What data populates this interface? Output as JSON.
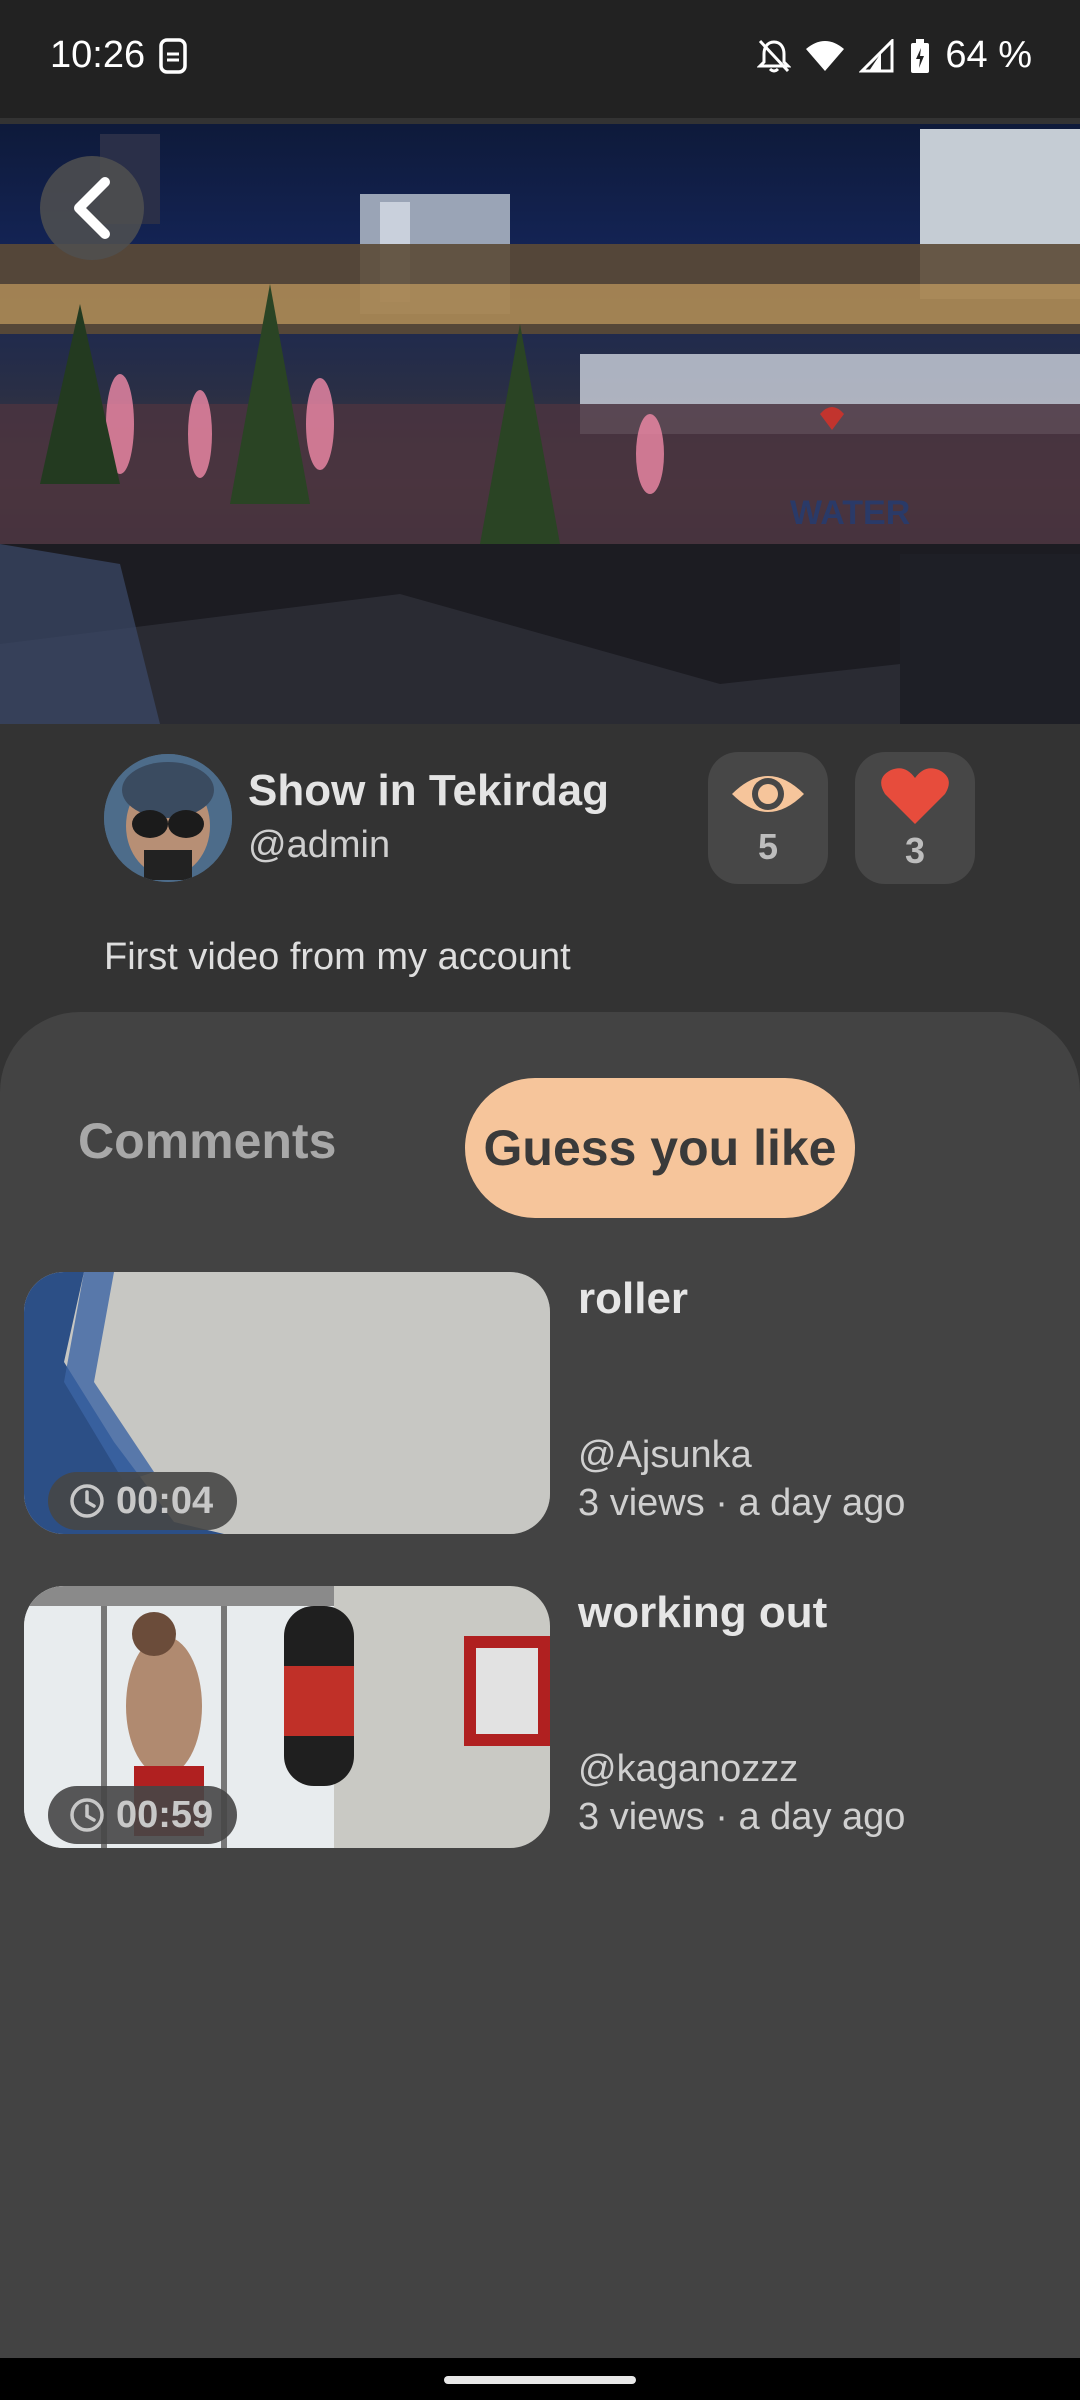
{
  "status_bar": {
    "time": "10:26",
    "battery": "64 %",
    "icons": [
      "dnd-off-icon",
      "wifi-icon",
      "signal-icon",
      "battery-icon"
    ]
  },
  "video": {
    "back_icon": "chevron-left-icon"
  },
  "post": {
    "title": "Show in Tekirdag",
    "author": "@admin",
    "views": "5",
    "likes": "3",
    "description": "First video from my account"
  },
  "tabs": {
    "comments": "Comments",
    "guess": "Guess you like"
  },
  "recommendations": [
    {
      "title": "roller",
      "author": "@Ajsunka",
      "meta": "3 views · a day ago",
      "duration": "00:04"
    },
    {
      "title": "working out",
      "author": "@kaganozzz",
      "meta": "3 views · a day ago",
      "duration": "00:59"
    }
  ],
  "colors": {
    "accent": "#f6c59b",
    "like": "#e74c3c",
    "background": "#333333",
    "sheet": "#434343"
  }
}
